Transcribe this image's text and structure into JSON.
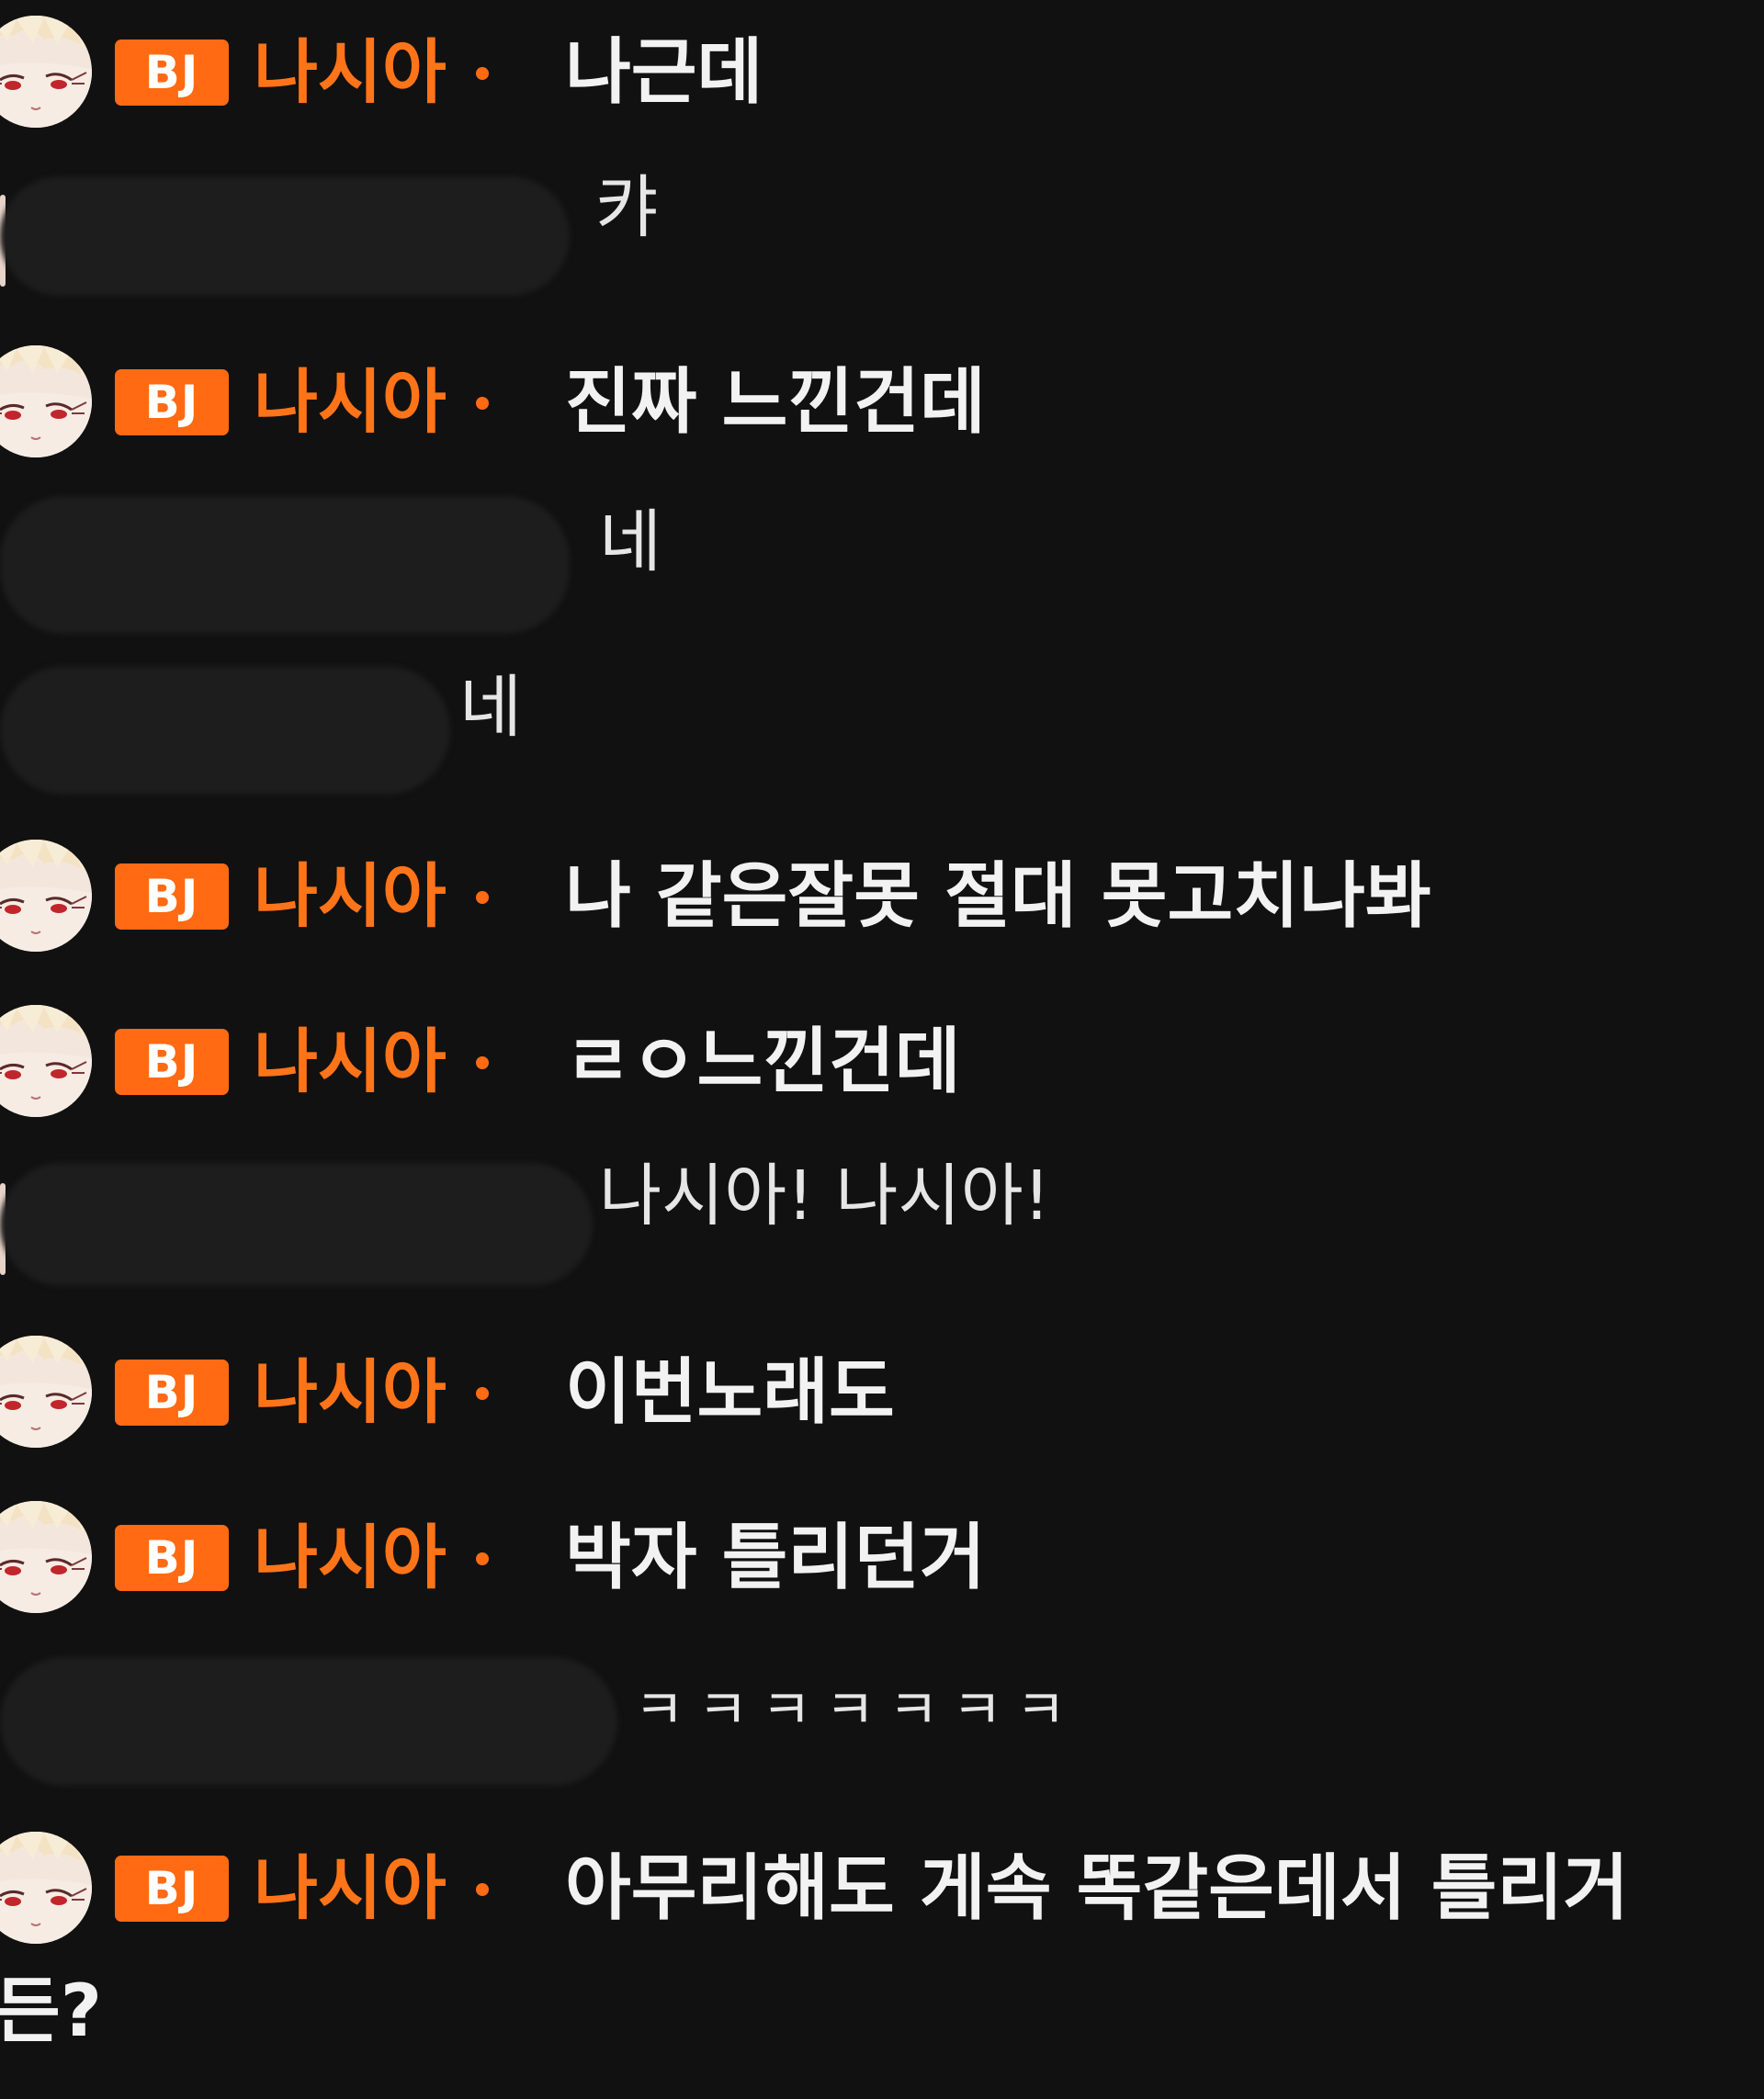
{
  "chat": {
    "badge_label": "BJ",
    "host_nick": "나시아",
    "messages": [
      {
        "type": "host",
        "text": "나근데"
      },
      {
        "type": "viewer",
        "text": "캬"
      },
      {
        "type": "host",
        "text": "진짜 느낀건데"
      },
      {
        "type": "viewer",
        "text": "네"
      },
      {
        "type": "viewer",
        "text": "네"
      },
      {
        "type": "host",
        "text": "나 같은잘못 절대 못고치나봐"
      },
      {
        "type": "host",
        "text": "ㄹㅇ느낀건데"
      },
      {
        "type": "viewer",
        "text": "나시아! 나시아!"
      },
      {
        "type": "host",
        "text": "이번노래도"
      },
      {
        "type": "host",
        "text": "박자 틀리던거"
      },
      {
        "type": "viewer",
        "text": "ㅋㅋㅋㅋㅋㅋㅋ"
      },
      {
        "type": "host",
        "text": "아무리해도 게속 똑같은데서 틀리거"
      }
    ],
    "continuation": "든?"
  },
  "colors": {
    "background": "#111111",
    "badge": "#ff6a13",
    "nick": "#ff7418",
    "text": "#f2f2f2",
    "redaction": "#1d1d1d"
  }
}
